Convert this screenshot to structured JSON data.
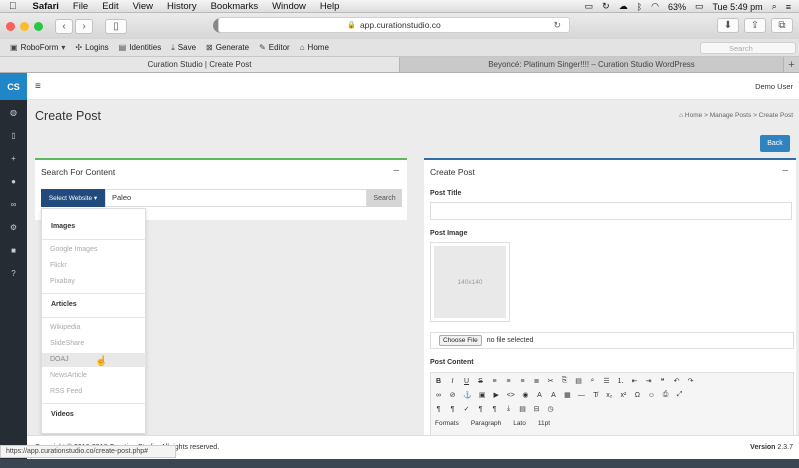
{
  "menubar": {
    "apple": "",
    "app": "Safari",
    "items": [
      "File",
      "Edit",
      "View",
      "History",
      "Bookmarks",
      "Window",
      "Help"
    ],
    "battery": "63%",
    "time": "Tue 5:49 pm"
  },
  "browser": {
    "address": "app.curationstudio.co",
    "bookmarks": [
      "RoboForm",
      "Logins",
      "Identities",
      "Save",
      "Generate",
      "Editor",
      "Home"
    ],
    "search_placeholder": "Search",
    "tabs": [
      "Curation Studio | Create Post",
      "Beyoncé: Platinum Singer!!!! – Curation Studio WordPress"
    ],
    "status_url": "https://app.curationstudio.co/create-post.php#"
  },
  "app": {
    "logo": "CS",
    "user": "Demo User",
    "page_title": "Create Post",
    "breadcrumb": [
      "Home",
      "Manage Posts",
      "Create Post"
    ],
    "back_label": "Back"
  },
  "search_panel": {
    "title": "Search For Content",
    "select_label": "Select Website ▾",
    "query": "Paleo",
    "search_label": "Search"
  },
  "dropdown": {
    "groups": [
      {
        "heading": "Images",
        "items": [
          "Google Images",
          "Flickr",
          "Pixabay"
        ]
      },
      {
        "heading": "Articles",
        "items": [
          "Wikipedia",
          "SlideShare",
          "DOAJ",
          "NewsArticle",
          "RSS Feed"
        ]
      },
      {
        "heading": "Videos",
        "items": []
      }
    ],
    "hovered": "DOAJ"
  },
  "create_panel": {
    "title": "Create Post",
    "post_title_label": "Post Title",
    "post_image_label": "Post Image",
    "image_placeholder": "140x140",
    "choose_file": "Choose File",
    "no_file": "no file selected",
    "post_content_label": "Post Content",
    "editor_formats": "Formats",
    "editor_paragraph": "Paragraph",
    "editor_font": "Lato",
    "editor_size": "11pt"
  },
  "footer": {
    "copyright_visible": "Copyright © 2016-2018 Curation Studio. All rights reserved.",
    "version_label": "Version",
    "version": "2.3.7"
  },
  "colors": {
    "sidebar": "#262c34",
    "accent": "#1f87c8",
    "select_btn": "#214a7d",
    "back_btn": "#2f83c1",
    "left_border": "#5cb85c",
    "right_border": "#2d6ea8"
  }
}
